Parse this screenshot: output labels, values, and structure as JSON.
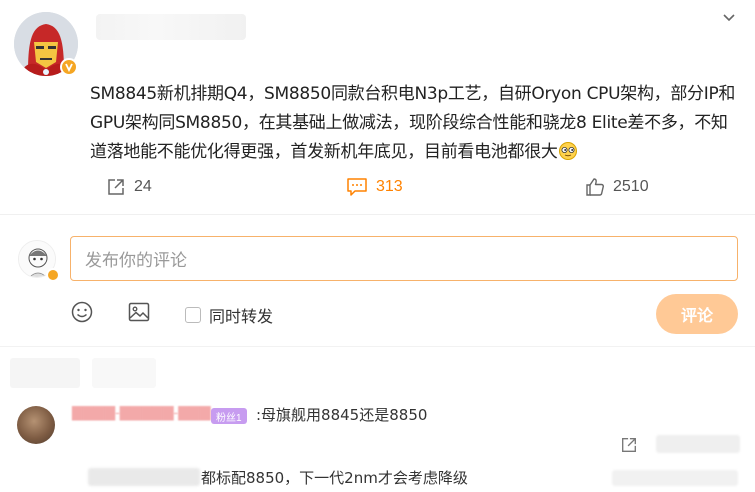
{
  "post": {
    "text": "SM8845新机排期Q4，SM8850同款台积电N3p工艺，自研Oryon CPU架构，部分IP和GPU架构同SM8850，在其基础上做减法，现阶段综合性能和骁龙8 Elite差不多，不知道落地能不能优化得更强，首发新机年底见，目前看电池都很大",
    "emoji": "smirk-face-emoji"
  },
  "actions": {
    "forward_count": "24",
    "comment_count": "313",
    "like_count": "2510"
  },
  "composer": {
    "placeholder": "发布你的评论",
    "repost_label": "同时转发",
    "submit_label": "评论"
  },
  "comment": {
    "fan_badge": "粉丝1",
    "text": ":母旗舰用8845还是8850",
    "reply_text": "都标配8850，下一代2nm才会考虑降级"
  },
  "colors": {
    "accent": "#ff8200",
    "input_border": "#f7b26b",
    "submit_bg": "#ffc996",
    "verified": "#f5a623"
  }
}
